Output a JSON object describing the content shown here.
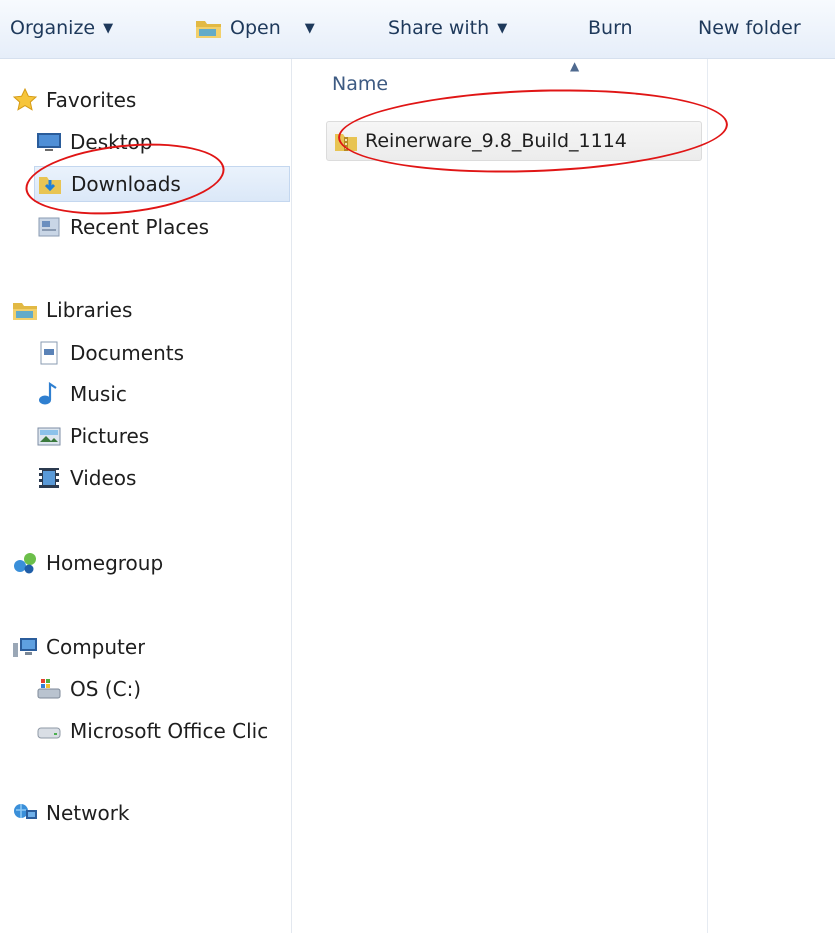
{
  "toolbar": {
    "organize": "Organize",
    "open": "Open",
    "share_with": "Share with",
    "burn": "Burn",
    "new_folder": "New folder"
  },
  "sidebar": {
    "favorites": "Favorites",
    "desktop": "Desktop",
    "downloads": "Downloads",
    "recent_places": "Recent Places",
    "libraries": "Libraries",
    "documents": "Documents",
    "music": "Music",
    "pictures": "Pictures",
    "videos": "Videos",
    "homegroup": "Homegroup",
    "computer": "Computer",
    "os_drive": "OS (C:)",
    "office_drive": "Microsoft Office Clic",
    "network": "Network"
  },
  "content": {
    "column_name": "Name",
    "files": [
      {
        "name": "Reinerware_9.8_Build_1114",
        "type": "folder"
      }
    ]
  },
  "colors": {
    "toolbar_text": "#1e395b",
    "selection": "#dbe8f8",
    "annotation": "#e01515"
  }
}
